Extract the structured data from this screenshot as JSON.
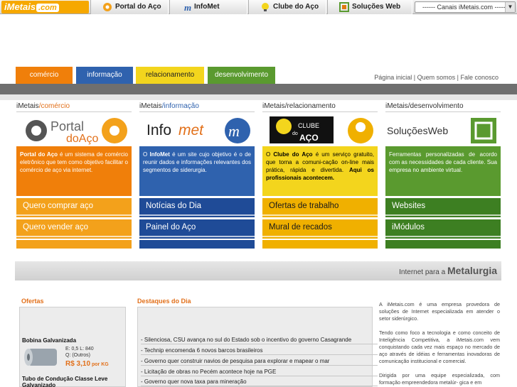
{
  "topbar": {
    "logo_prefix": "i",
    "logo_main": "Metais",
    "logo_suffix": ".com",
    "tabs": [
      {
        "label": "Portal do Aço",
        "icon": "gear-icon"
      },
      {
        "label": "InfoMet",
        "icon": "infomet-m-icon"
      },
      {
        "label": "Clube do Aço",
        "icon": "bulb-icon"
      },
      {
        "label": "Soluções Web",
        "icon": "square-frame-icon"
      }
    ],
    "channels_select": "------ Canais iMetais.com ------"
  },
  "category_tabs": [
    {
      "label": "comércio",
      "color": "#f07f0a"
    },
    {
      "label": "informação",
      "color": "#2f62ae"
    },
    {
      "label": "relacionamento",
      "color": "#f3d51d"
    },
    {
      "label": "desenvolvimento",
      "color": "#5a9a2f"
    }
  ],
  "top_links": [
    "Página inicial",
    "Quem somos",
    "Fale conosco"
  ],
  "columns": [
    {
      "title_brand": "iMetais",
      "title_section": "/comércio",
      "logo_text_1": "Portal",
      "logo_text_2": "doAço",
      "desc_bold": "Portal do Aço",
      "desc": " é um sistema de comércio eletrônico que tem como objetivo facilitar o comércio de aço via internet.",
      "links": [
        "Quero comprar aço",
        "Quero vender aço"
      ]
    },
    {
      "title_brand": "iMetais",
      "title_section": "/informação",
      "logo_text_1": "Info",
      "logo_text_2": "met",
      "desc_prefix": "O ",
      "desc_bold": "InfoMet",
      "desc": " é um site cujo objetivo é o de reunir dados e informações relevantes dos segmentos de siderurgia.",
      "links": [
        "Notícias do Dia",
        "Painel do Aço"
      ]
    },
    {
      "title_brand": "iMetais",
      "title_section": "/relacionamento",
      "logo_text_1": "CLUBE",
      "logo_text_2": "do",
      "logo_text_3": "AÇO",
      "desc_prefix": "O ",
      "desc_bold": "Clube do Aço",
      "desc": " é um serviço gratuito, que torna a comuni-cação on-line mais prática, rápida e divertida. ",
      "desc_bold2": "Aqui os profissionais acontecem.",
      "links": [
        "Ofertas de trabalho",
        "Mural de recados"
      ]
    },
    {
      "title_brand": "iMetais",
      "title_section": "/desenvolvimento",
      "logo_text_1": "SoluçõesWeb",
      "desc": "Ferramentas personalizadas de acordo com as necessidades de cada cliente. Sua empresa no ambiente virtual.",
      "links": [
        "Websites",
        "iMódulos"
      ]
    }
  ],
  "banner": {
    "prefix": "Internet para a ",
    "main": "Metalurgia"
  },
  "offers": {
    "heading": "Ofertas",
    "item1_title": "Bobina Galvanizada",
    "item1_spec1": "E: 0,5  L: 840",
    "item1_spec2": "Q: (Outros)",
    "item1_price": "R$ 3,10",
    "item1_unit": " por KG",
    "item2_title": "Tubo de Condução Classe Leve Galvanizado"
  },
  "news": {
    "heading": "Destaques do Dia",
    "items": [
      "- Silenciosa, CSU avança no sul do Estado sob o incentivo do governo Casagrande",
      "- Technip encomenda 6 novos barcos brasileiros",
      "- Governo quer construir navios de pesquisa para explorar e mapear o mar",
      "- Licitação de obras no Pecém acontece hoje na PGE",
      "- Governo quer nova taxa para mineração"
    ]
  },
  "about": {
    "p1": "A iMetais.com é uma empresa provedora de soluções de Internet especializada em atender o setor siderúrgico.",
    "p2": "Tendo como foco a tecnologia e como conceito de Inteligência Competitiva, a iMetais.com vem conquistando cada vez mais espaço no mercado de aço através de idéias e ferramentas inovadoras de comunicação institucional e comercial.",
    "p3": "Dirigida por uma equipe especializada, com formação empreendedora metalúr- gica e em"
  }
}
